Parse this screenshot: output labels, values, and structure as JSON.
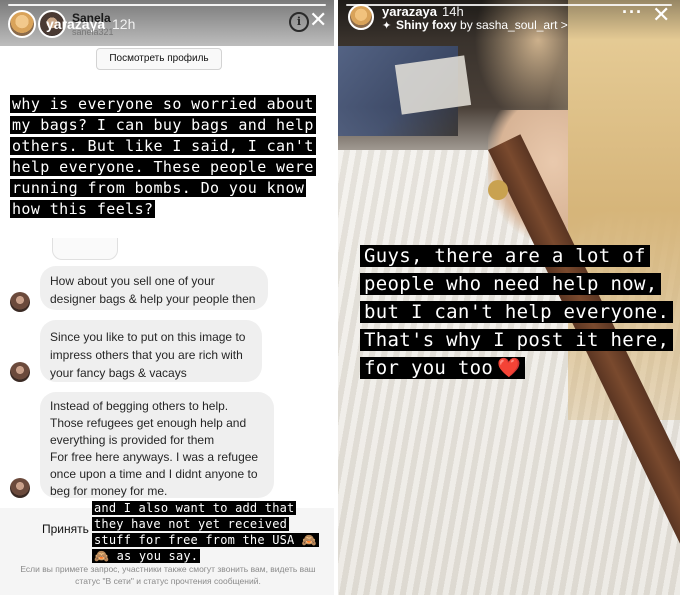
{
  "left": {
    "story_header": {
      "username": "yarazaya",
      "time": "12h",
      "close_icon": "close-icon"
    },
    "dm_header": {
      "name": "Sanela",
      "handle": "sanela321",
      "info_icon": "info-icon"
    },
    "view_profile_button": "Посмотреть профиль",
    "overlay_text": "why is everyone so worried about my bags?  I can buy bags and help others. But like I said, I can't help everyone.  These people were running from bombs.  Do you know how this feels?",
    "messages": [
      {
        "lines": [
          "How about you sell one of your",
          "designer bags & help your people then"
        ]
      },
      {
        "lines": [
          "Since you like to put on this image to",
          "impress others that you are rich with",
          "your fancy bags & vacays"
        ]
      },
      {
        "lines": [
          "Instead of begging others to help.",
          "Those refugees get enough help and",
          "everything is provided for them",
          "For free here anyways. I was a refugee",
          "once upon a time and I didnt anyone to",
          "beg for money for me."
        ]
      }
    ],
    "accept_button": "Принять",
    "overlay_text_2": "and I also want to add that they have not yet received stuff  for free from the USA  🙈🙈  as you say.",
    "fine_print": "Если вы примете запрос, участники также смогут звонить вам, видеть ваш статус \"В сети\" и статус прочтения сообщений."
  },
  "right": {
    "username": "yarazaya",
    "time": "14h",
    "music_icon": "sparkle-icon",
    "music_title": "Shiny foxy",
    "music_by": "by sasha_soul_art",
    "music_chevron": ">",
    "more_icon": "more-dots-icon",
    "close_icon": "close-icon",
    "overlay_text": "Guys, there are a lot of people who need help now, but I can't help everyone. That's why I post it here, for you too",
    "heart_emoji": "❤️"
  },
  "colors": {
    "caption_bg": "#000000",
    "caption_fg": "#ffffff",
    "bubble_bg": "#efefef",
    "heart": "#e0242b"
  }
}
